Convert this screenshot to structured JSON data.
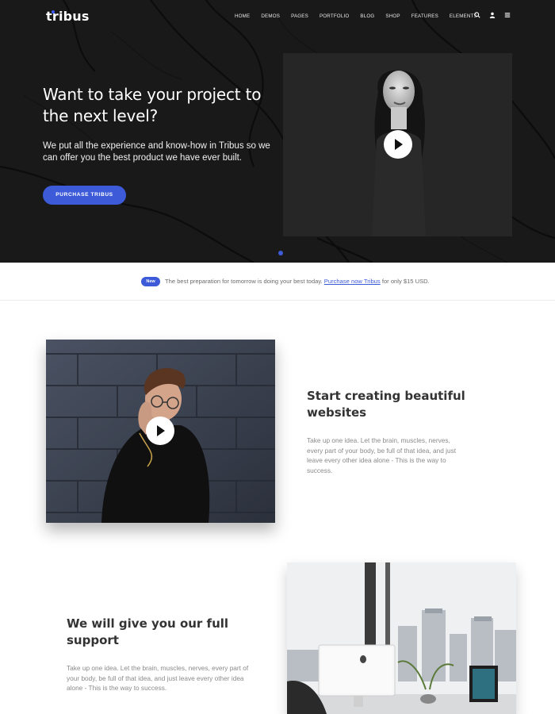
{
  "brand": {
    "name": "tribus",
    "accent": "#3d5bd8"
  },
  "nav": {
    "items": [
      "HOME",
      "DEMOS",
      "PAGES",
      "PORTFOLIO",
      "BLOG",
      "SHOP",
      "FEATURES",
      "ELEMENTS"
    ],
    "icons": [
      "search-icon",
      "user-icon",
      "menu-icon"
    ]
  },
  "hero": {
    "title": "Want to take your project to the next level?",
    "text": "We put all the experience and know-how in Tribus so we can offer you the best product we have ever built.",
    "button": "PURCHASE TRIBUS"
  },
  "notice": {
    "badge": "New",
    "text_before": "The best preparation for tomorrow is doing your best today.",
    "link": "Purchase now Tribus",
    "text_after": "for only $15 USD."
  },
  "section1": {
    "title": "Start creating beautiful websites",
    "text": "Take up one idea. Let the brain, muscles, nerves, every part of your body, be full of that idea, and just leave every other idea alone - This is the way to success."
  },
  "section2": {
    "title": "We will give you our full support",
    "text": "Take up one idea. Let the brain, muscles, nerves, every part of your body, be full of that idea, and just leave every other idea alone - This is the way to success."
  }
}
